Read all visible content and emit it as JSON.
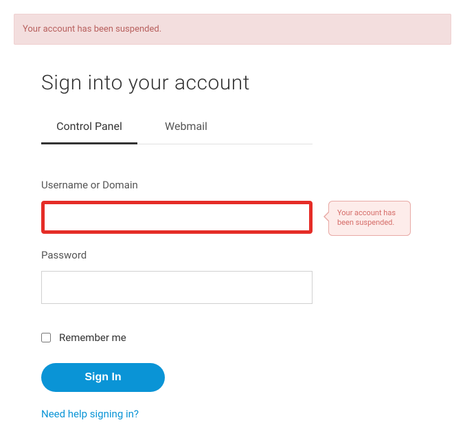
{
  "banner": {
    "message": "Your account has been suspended."
  },
  "heading": "Sign into your account",
  "tabs": {
    "control_panel": "Control Panel",
    "webmail": "Webmail"
  },
  "form": {
    "username_label": "Username or Domain",
    "username_value": "",
    "password_label": "Password",
    "password_value": "",
    "tooltip_message": "Your account has been suspended.",
    "remember_label": "Remember me",
    "signin_label": "Sign In",
    "help_link": "Need help signing in?"
  },
  "colors": {
    "error_bg": "#f3dede",
    "error_text": "#b8605e",
    "accent": "#0a94d6",
    "error_border": "#e52d27"
  }
}
